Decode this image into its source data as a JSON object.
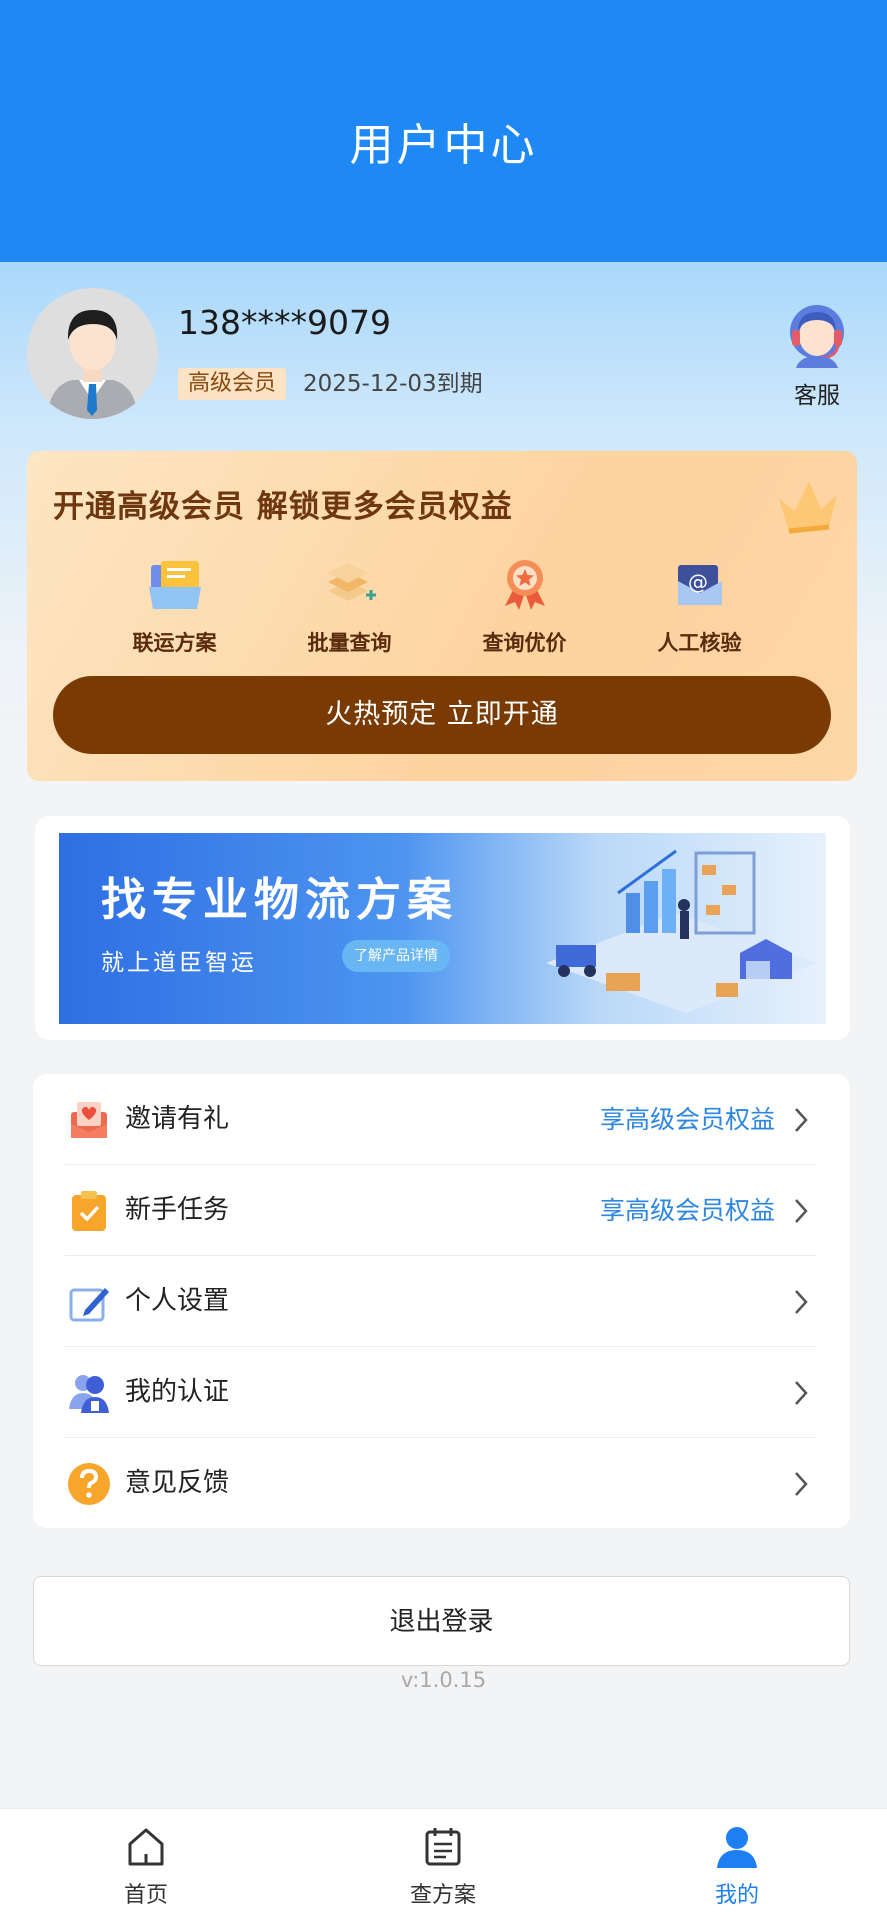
{
  "header": {
    "title": "用户中心"
  },
  "profile": {
    "phone": "138****9079",
    "member_badge": "高级会员",
    "expiry": "2025-12-03到期",
    "service_label": "客服"
  },
  "vip": {
    "title": "开通高级会员 解锁更多会员权益",
    "perks": [
      {
        "label": "联运方案",
        "icon": "document-icon"
      },
      {
        "label": "批量查询",
        "icon": "layers-plus-icon"
      },
      {
        "label": "查询优价",
        "icon": "medal-icon"
      },
      {
        "label": "人工核验",
        "icon": "email-at-icon"
      }
    ],
    "button_label": "火热预定 立即开通",
    "colors": {
      "button": "#7a3a04",
      "card": "#fdd39e"
    }
  },
  "banner": {
    "headline": "找专业物流方案",
    "subline": "就上道臣智运",
    "pill": "了解产品详情"
  },
  "menu": {
    "items": [
      {
        "label": "邀请有礼",
        "right": "享高级会员权益",
        "icon": "gift-envelope-icon"
      },
      {
        "label": "新手任务",
        "right": "享高级会员权益",
        "icon": "task-clipboard-icon"
      },
      {
        "label": "个人设置",
        "right": "",
        "icon": "edit-pen-icon"
      },
      {
        "label": "我的认证",
        "right": "",
        "icon": "user-verify-icon"
      },
      {
        "label": "意见反馈",
        "right": "",
        "icon": "question-icon"
      }
    ]
  },
  "logout_label": "退出登录",
  "version": "v:1.0.15",
  "tabbar": {
    "tabs": [
      {
        "label": "首页",
        "icon": "home-icon",
        "active": false
      },
      {
        "label": "查方案",
        "icon": "calendar-list-icon",
        "active": false
      },
      {
        "label": "我的",
        "icon": "user-icon",
        "active": true
      }
    ]
  },
  "colors": {
    "header": "#1e88f5",
    "link": "#2d86df",
    "active_tab": "#1e7ff0"
  }
}
